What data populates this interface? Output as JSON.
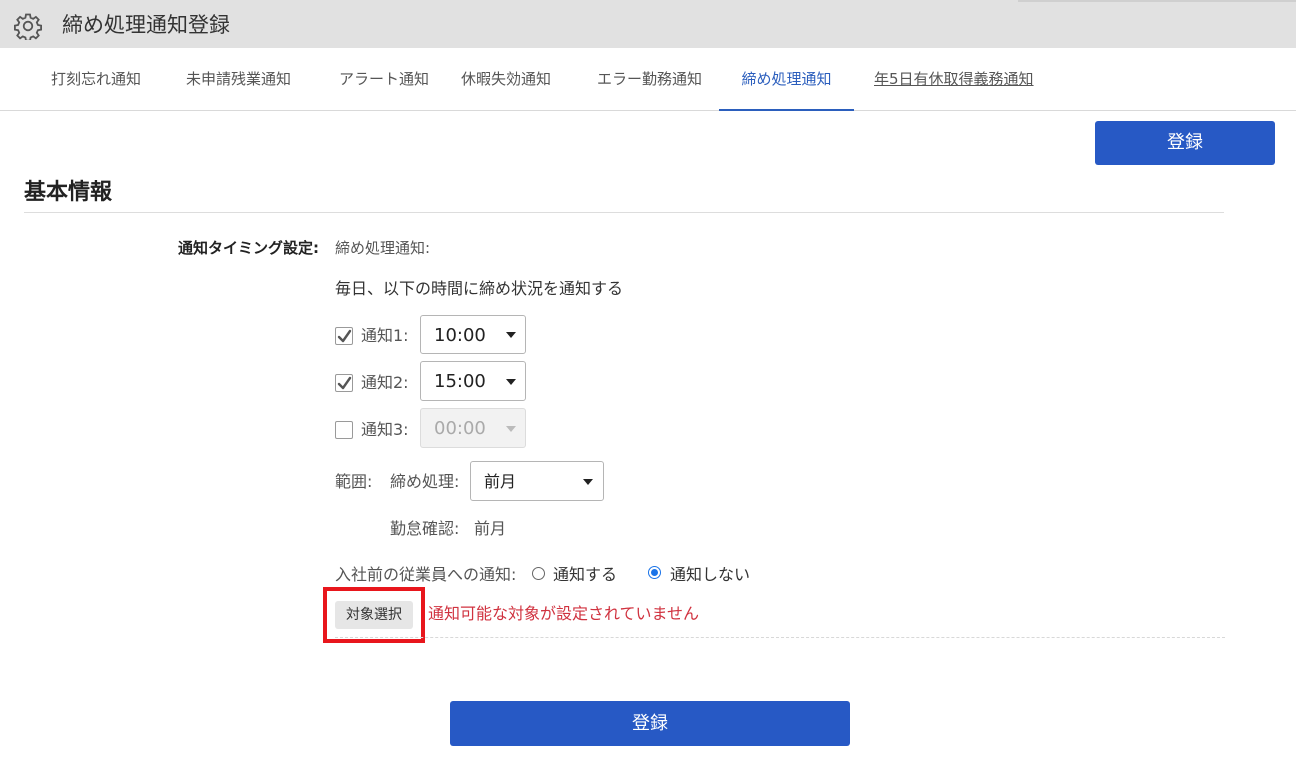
{
  "header": {
    "title": "締め処理通知登録",
    "icon": "gear-icon"
  },
  "tabs": [
    {
      "label": "打刻忘れ通知"
    },
    {
      "label": "未申請残業通知"
    },
    {
      "label": "アラート通知"
    },
    {
      "label": "休暇失効通知"
    },
    {
      "label": "エラー勤務通知"
    },
    {
      "label": "締め処理通知",
      "active": true
    },
    {
      "label": "年5日有休取得義務通知"
    }
  ],
  "buttons": {
    "register_top": "登録",
    "register_bottom": "登録",
    "target_select": "対象選択"
  },
  "section": {
    "title": "基本情報"
  },
  "timing": {
    "label": "通知タイミング設定:",
    "type_label": "締め処理通知:",
    "description": "毎日、以下の時間に締め状況を通知する",
    "notifications": [
      {
        "label": "通知1:",
        "checked": true,
        "time": "10:00",
        "enabled": true
      },
      {
        "label": "通知2:",
        "checked": true,
        "time": "15:00",
        "enabled": true
      },
      {
        "label": "通知3:",
        "checked": false,
        "time": "00:00",
        "enabled": false
      }
    ]
  },
  "range": {
    "label": "範囲:",
    "closing_label": "締め処理:",
    "closing_value": "前月",
    "attendance_label": "勤怠確認:",
    "attendance_value": "前月"
  },
  "pre_hire": {
    "label": "入社前の従業員への通知:",
    "options": [
      {
        "label": "通知する",
        "selected": false
      },
      {
        "label": "通知しない",
        "selected": true
      }
    ]
  },
  "target": {
    "error": "通知可能な対象が設定されていません"
  },
  "colors": {
    "primary": "#2759c5",
    "active_tab": "#2b5ebd",
    "error": "#d0323f",
    "highlight": "#e8161c",
    "radio_selected": "#1a73e8"
  }
}
